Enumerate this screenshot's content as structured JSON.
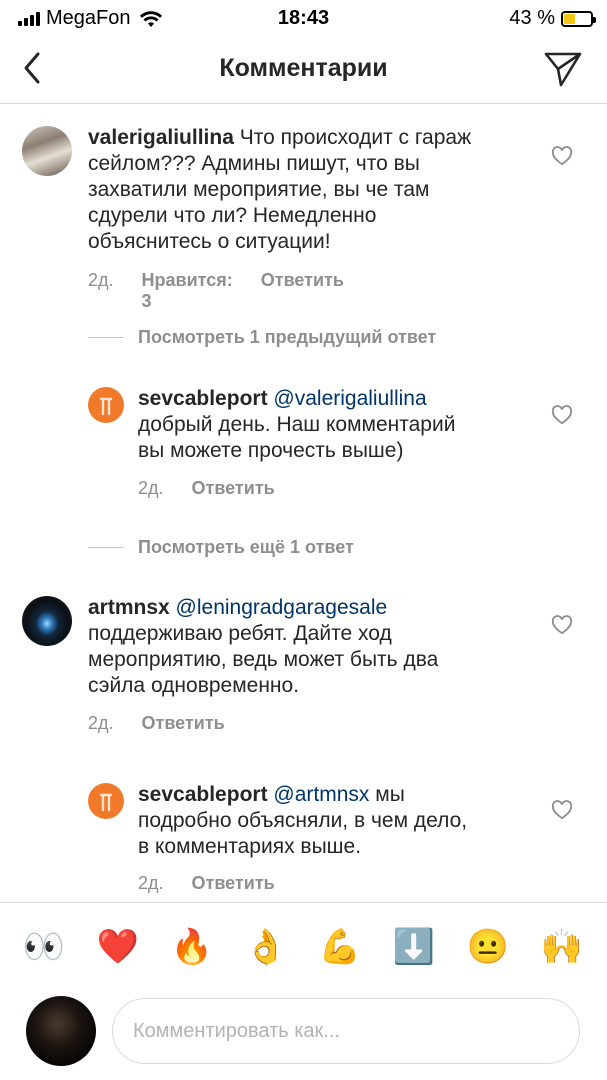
{
  "status_bar": {
    "carrier": "MegaFon",
    "time": "18:43",
    "battery_percent": "43 %",
    "battery_level": 0.43
  },
  "header": {
    "title": "Комментарии",
    "back_icon": "chevron-left-icon",
    "send_icon": "paper-plane-icon"
  },
  "comments": [
    {
      "username": "valerigaliullina",
      "lines": [
        "Что происходит с гараж",
        "сейлом??? Админы пишут, что вы",
        "захватили мероприятие, вы че там",
        "сдурели что ли? Немедленно",
        "объяснитесь о ситуации!"
      ],
      "time": "2д.",
      "likes": "Нравится: 3",
      "reply": "Ответить"
    },
    {
      "username": "sevcableport",
      "mention": "@valerigaliullina",
      "lines": [
        "добрый день. Наш комментарий",
        "вы можете прочесть выше)"
      ],
      "time": "2д.",
      "reply": "Ответить"
    },
    {
      "username": "artmnsx",
      "mention": "@leningradgaragesale",
      "lines": [
        "поддерживаю ребят. Дайте ход",
        "мероприятию, ведь может быть два",
        "сэйла одновременно."
      ],
      "time": "2д.",
      "reply": "Ответить"
    },
    {
      "username": "sevcableport",
      "mention": "@artmnsx",
      "first_line_rest": "мы",
      "lines": [
        "подробно объясняли, в чем дело,",
        "в комментариях выше."
      ],
      "time": "2д.",
      "reply": "Ответить"
    }
  ],
  "view_previous_reply": "Посмотреть 1 предыдущий ответ",
  "view_more_reply": "Посмотреть ещё 1 ответ",
  "emojis": [
    "👀",
    "❤️",
    "🔥",
    "👌",
    "💪",
    "⬇️",
    "😐",
    "🙌"
  ],
  "input": {
    "placeholder": "Комментировать как..."
  },
  "colors": {
    "mention": "#003569",
    "secondary_text": "#8e8e8e",
    "battery": "#f5c518"
  }
}
